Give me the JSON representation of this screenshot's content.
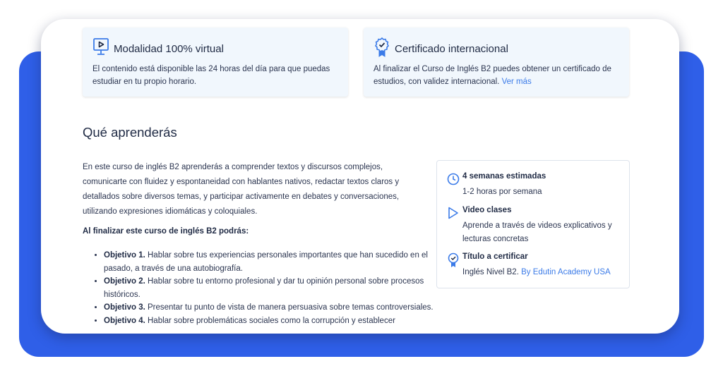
{
  "features": [
    {
      "icon": "video-play-icon",
      "title": "Modalidad 100% virtual",
      "description": "El contenido está disponible las 24 horas del día para que puedas estudiar en tu propio horario."
    },
    {
      "icon": "certificate-badge-icon",
      "title": "Certificado internacional",
      "description": "Al finalizar el Curso de Inglés B2 puedes obtener un certificado de estudios, con validez internacional.",
      "link": "Ver más"
    }
  ],
  "learn": {
    "heading": "Qué aprenderás",
    "paragraph": "En este curso de inglés B2 aprenderás a comprender textos y discursos complejos, comunicarte con fluidez y espontaneidad con hablantes nativos, redactar textos claros y detallados sobre diversos temas, y participar activamente en debates y conversaciones, utilizando expresiones idiomáticas y coloquiales.",
    "subheading": "Al finalizar este curso de inglés B2 podrás:",
    "objectives": [
      {
        "label": "Objetivo 1.",
        "text": "Hablar sobre tus experiencias personales importantes que han sucedido en el pasado, a través de una autobiografía."
      },
      {
        "label": "Objetivo 2.",
        "text": "Hablar sobre tu entorno profesional y dar tu opinión personal sobre procesos históricos."
      },
      {
        "label": "Objetivo 3.",
        "text": "Presentar tu punto de vista de manera persuasiva sobre temas controversiales."
      },
      {
        "label": "Objetivo 4.",
        "text": "Hablar sobre problemáticas sociales como la corrupción y establecer"
      }
    ]
  },
  "info_box": {
    "items": [
      {
        "icon": "clock-icon",
        "title": "4 semanas estimadas",
        "subtitle": "1-2 horas por semana"
      },
      {
        "icon": "play-triangle-icon",
        "title": "Video clases",
        "subtitle": "Aprende a través de videos explicativos y lecturas concretas"
      },
      {
        "icon": "certificate-badge-icon",
        "title": "Título a certificar",
        "subtitle": "Inglés Nivel B2.",
        "link": "By Edutin Academy USA"
      }
    ]
  },
  "colors": {
    "accent_blue": "#2f5fe8",
    "link_blue": "#3b7be8",
    "feature_bg": "#f1f7fd",
    "text_dark": "#1f2a44"
  }
}
